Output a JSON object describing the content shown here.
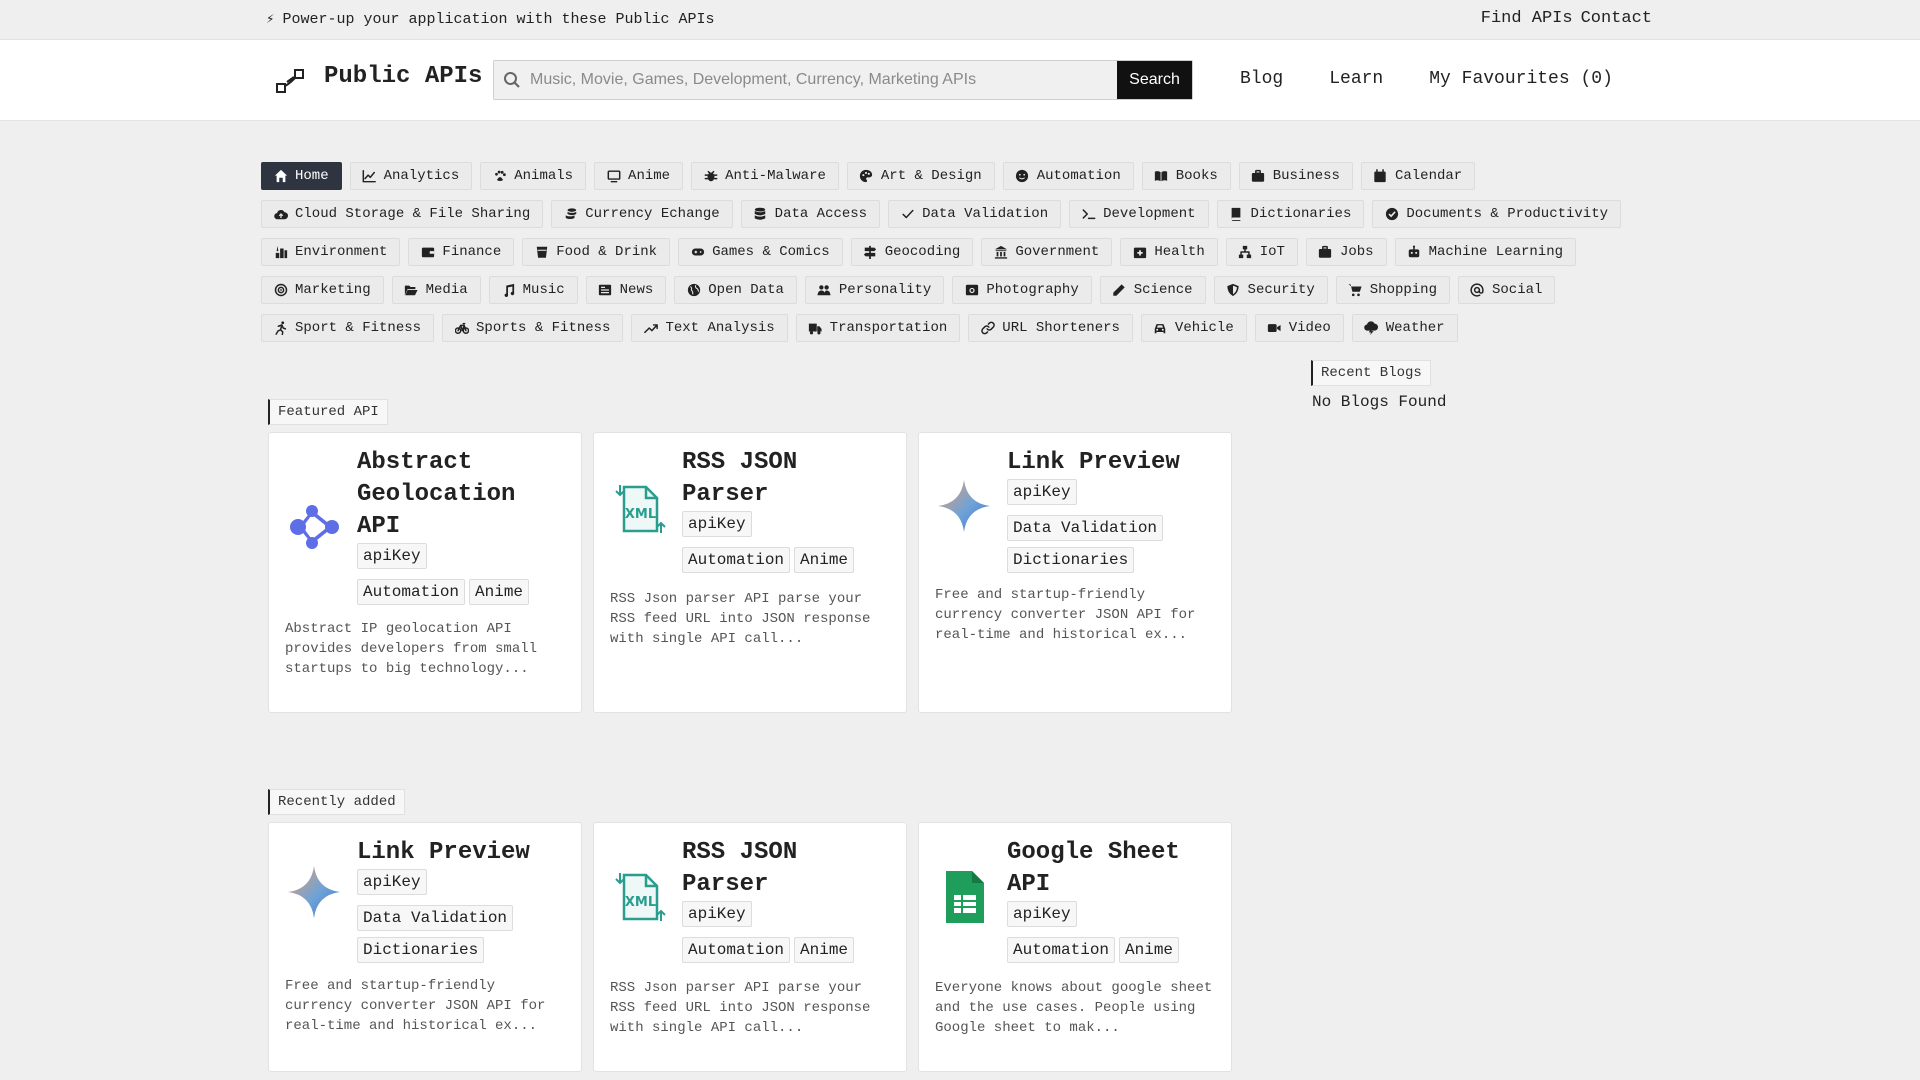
{
  "topbar": {
    "promo": "Power-up your application with these Public APIs",
    "links": [
      "Find APIs",
      "Contact"
    ]
  },
  "header": {
    "brand": "Public APIs",
    "search": {
      "placeholder": "Music, Movie, Games, Development, Currency, Marketing APIs",
      "value": "",
      "button": "Search"
    },
    "nav": [
      "Blog",
      "Learn",
      "My Favourites (0)"
    ]
  },
  "categories": [
    [
      {
        "label": "Home",
        "icon": "home-icon"
      },
      {
        "label": "Analytics",
        "icon": "chart-line-icon"
      },
      {
        "label": "Animals",
        "icon": "paw-icon"
      },
      {
        "label": "Anime",
        "icon": "monitor-icon"
      },
      {
        "label": "Anti-Malware",
        "icon": "bug-icon"
      },
      {
        "label": "Art & Design",
        "icon": "palette-icon"
      },
      {
        "label": "Automation",
        "icon": "robot-face-icon"
      },
      {
        "label": "Books",
        "icon": "book-open-icon"
      },
      {
        "label": "Business",
        "icon": "briefcase-icon"
      },
      {
        "label": "Calendar",
        "icon": "calendar-icon"
      }
    ],
    [
      {
        "label": "Cloud Storage & File Sharing",
        "icon": "cloud-upload-icon"
      },
      {
        "label": "Currency Echange",
        "icon": "coins-icon"
      },
      {
        "label": "Data Access",
        "icon": "database-icon"
      },
      {
        "label": "Data Validation",
        "icon": "check-icon"
      },
      {
        "label": "Development",
        "icon": "terminal-icon"
      },
      {
        "label": "Dictionaries",
        "icon": "book-icon"
      },
      {
        "label": "Documents & Productivity",
        "icon": "check-circle-icon"
      }
    ],
    [
      {
        "label": "Environment",
        "icon": "leaf-icon"
      },
      {
        "label": "Finance",
        "icon": "wallet-icon"
      },
      {
        "label": "Food & Drink",
        "icon": "drink-icon"
      },
      {
        "label": "Games & Comics",
        "icon": "gamepad-icon"
      },
      {
        "label": "Geocoding",
        "icon": "signpost-icon"
      },
      {
        "label": "Government",
        "icon": "building-columns-icon"
      },
      {
        "label": "Health",
        "icon": "medical-kit-icon"
      },
      {
        "label": "IoT",
        "icon": "network-icon"
      },
      {
        "label": "Jobs",
        "icon": "briefcase-icon"
      },
      {
        "label": "Machine Learning",
        "icon": "robot-icon"
      }
    ],
    [
      {
        "label": "Marketing",
        "icon": "target-icon"
      },
      {
        "label": "Media",
        "icon": "folder-open-icon"
      },
      {
        "label": "Music",
        "icon": "music-icon"
      },
      {
        "label": "News",
        "icon": "newspaper-icon"
      },
      {
        "label": "Open Data",
        "icon": "globe-icon"
      },
      {
        "label": "Personality",
        "icon": "users-icon"
      },
      {
        "label": "Photography",
        "icon": "camera-icon"
      },
      {
        "label": "Science",
        "icon": "pencil-icon"
      },
      {
        "label": "Security",
        "icon": "shield-icon"
      },
      {
        "label": "Shopping",
        "icon": "cart-icon"
      },
      {
        "label": "Social",
        "icon": "at-icon"
      }
    ],
    [
      {
        "label": "Sport & Fitness",
        "icon": "runner-icon"
      },
      {
        "label": "Sports & Fitness",
        "icon": "bicycle-icon"
      },
      {
        "label": "Text Analysis",
        "icon": "trend-icon"
      },
      {
        "label": "Transportation",
        "icon": "truck-icon"
      },
      {
        "label": "URL Shorteners",
        "icon": "link-icon"
      },
      {
        "label": "Vehicle",
        "icon": "car-icon"
      },
      {
        "label": "Video",
        "icon": "video-icon"
      },
      {
        "label": "Weather",
        "icon": "cloud-bolt-icon"
      }
    ]
  ],
  "sections": {
    "featured": "Featured API",
    "recent": "Recently added",
    "blogs": "Recent Blogs",
    "no_blogs": "No Blogs Found"
  },
  "featured": [
    {
      "title": "Abstract Geolocation API",
      "auth": "apiKey",
      "tags": [
        "Automation",
        "Anime"
      ],
      "desc": "Abstract IP geolocation API provides developers from small startups to big technology...",
      "logo": "abstract-logo-icon"
    },
    {
      "title": "RSS JSON Parser",
      "auth": "apiKey",
      "tags": [
        "Automation",
        "Anime"
      ],
      "desc": "RSS Json parser API parse your RSS feed URL into JSON response with single API call...",
      "logo": "xml-file-icon"
    },
    {
      "title": "Link Preview",
      "auth": "apiKey",
      "tags": [
        "Data Validation",
        "Dictionaries"
      ],
      "desc": "Free and startup-friendly currency converter JSON API for real-time and historical ex...",
      "logo": "sparkle-icon"
    }
  ],
  "recent": [
    {
      "title": "Link Preview",
      "auth": "apiKey",
      "tags": [
        "Data Validation",
        "Dictionaries"
      ],
      "desc": "Free and startup-friendly currency converter JSON API for real-time and historical ex...",
      "logo": "sparkle-icon"
    },
    {
      "title": "RSS JSON Parser",
      "auth": "apiKey",
      "tags": [
        "Automation",
        "Anime"
      ],
      "desc": "RSS Json parser API parse your RSS feed URL into JSON response with single API call...",
      "logo": "xml-file-icon"
    },
    {
      "title": "Google Sheet API",
      "auth": "apiKey",
      "tags": [
        "Automation",
        "Anime"
      ],
      "desc": "Everyone knows about google sheet and the use cases. People using Google sheet to mak...",
      "logo": "google-sheets-icon"
    }
  ],
  "colors": {
    "active_chip": "#2e3440",
    "search_button": "#111111",
    "abstract_logo": "#5d6ee6",
    "xml_logo": "#2a9d8f",
    "sheets_logo": "#1e9e5a"
  }
}
